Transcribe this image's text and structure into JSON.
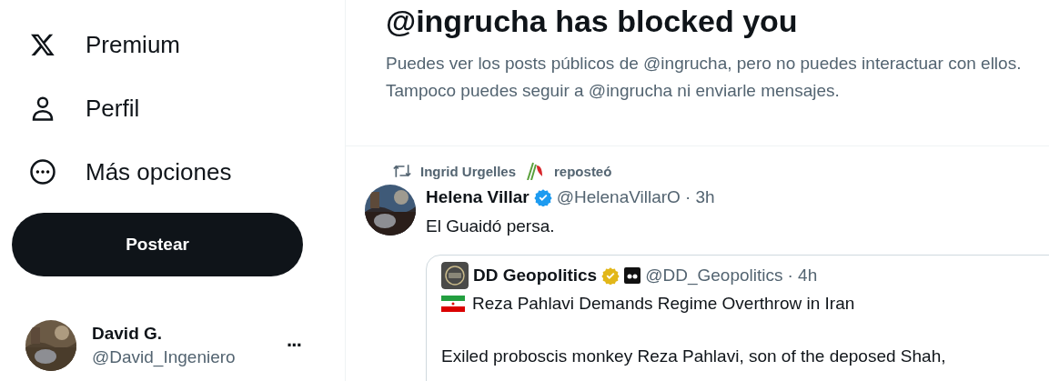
{
  "sidebar": {
    "nav": [
      {
        "kind": "x",
        "label": "Premium"
      },
      {
        "kind": "person",
        "label": "Perfil"
      },
      {
        "kind": "more",
        "label": "Más opciones"
      }
    ],
    "post_button": "Postear",
    "account": {
      "name": "David G.",
      "handle": "@David_Ingeniero",
      "more": "···"
    }
  },
  "notice": {
    "title": "@ingrucha has blocked you",
    "text": "Puedes ver los posts públicos de @ingrucha, pero no puedes interactuar con ellos. Tampoco puedes seguir a @ingrucha ni enviarle mensajes."
  },
  "post": {
    "repost": {
      "name": "Ingrid Urgelles",
      "action": "reposteó"
    },
    "author": {
      "name": "Helena Villar",
      "verified": true,
      "color": "#1d9bf0",
      "handle": "@HelenaVillarO",
      "time": "· 3h"
    },
    "text": "El Guaidó persa.",
    "quote": {
      "author": {
        "name": "DD Geopolitics",
        "verified": true,
        "color": "#e2b719",
        "affiliate": true,
        "handle": "@DD_Geopolitics",
        "time": "· 4h"
      },
      "headline": "Reza Pahlavi Demands Regime Overthrow in Iran",
      "body": "Exiled proboscis monkey Reza Pahlavi, son of the deposed Shah,"
    }
  }
}
